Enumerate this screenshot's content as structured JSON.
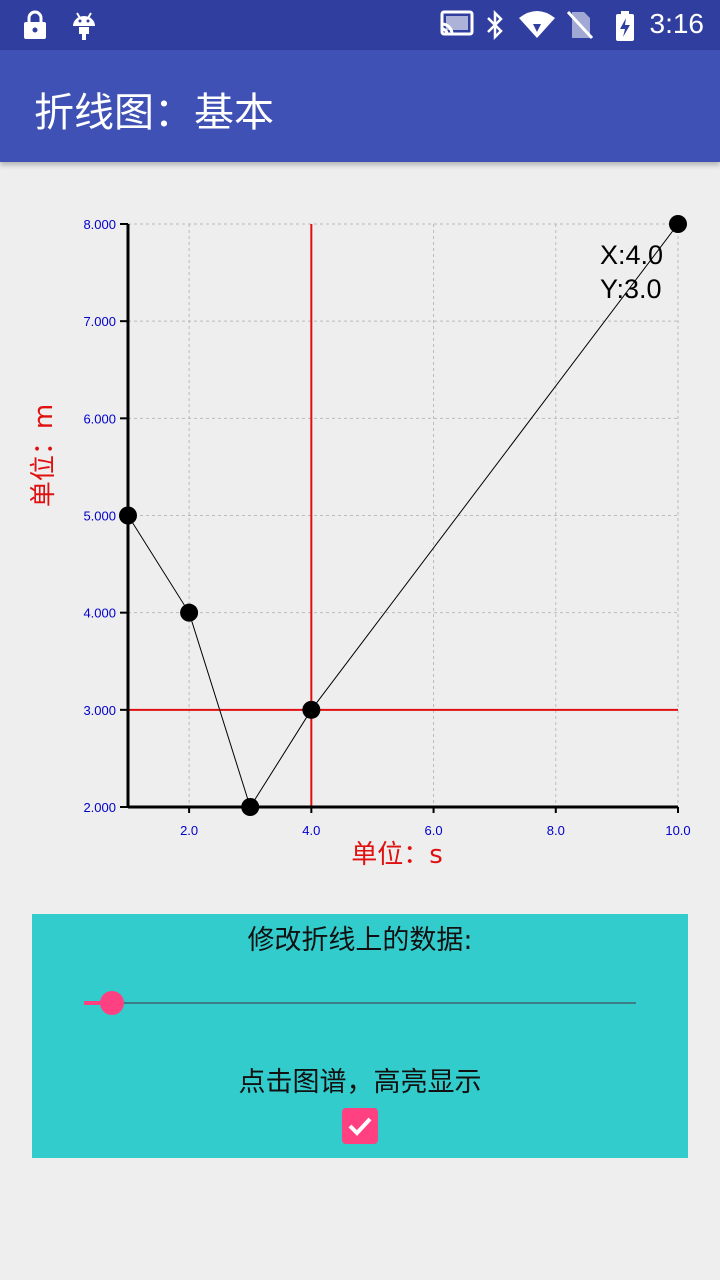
{
  "status_bar": {
    "time": "3:16",
    "icons": [
      "lock-icon",
      "android-icon",
      "cast-icon",
      "bluetooth-icon",
      "wifi-icon",
      "no-sim-icon",
      "battery-charging-icon"
    ]
  },
  "app_bar": {
    "title": "折线图：基本"
  },
  "chart_data": {
    "type": "line",
    "x": [
      1.0,
      2.0,
      3.0,
      4.0,
      10.0
    ],
    "y": [
      5.0,
      4.0,
      2.0,
      3.0,
      8.0
    ],
    "xlim": [
      1.0,
      10.0
    ],
    "ylim": [
      2.0,
      8.0
    ],
    "xticks": [
      2.0,
      4.0,
      6.0,
      8.0,
      10.0
    ],
    "yticks": [
      2.0,
      3.0,
      4.0,
      5.0,
      6.0,
      7.0,
      8.0
    ],
    "xtick_labels": [
      "2.0",
      "4.0",
      "6.0",
      "8.0",
      "10.0"
    ],
    "ytick_labels": [
      "2.000",
      "3.000",
      "4.000",
      "5.000",
      "6.000",
      "7.000",
      "8.000"
    ],
    "xlabel": "单位：s",
    "ylabel": "单位：m",
    "grid": true,
    "highlight": {
      "x": 4.0,
      "y": 3.0,
      "label_x": "X:4.0",
      "label_y": "Y:3.0"
    },
    "colors": {
      "line": "#000000",
      "marker": "#000000",
      "crosshair": "#e01010",
      "tick_label": "#0000cc",
      "axis_title": "#e01010",
      "grid": "#bbbbbb"
    }
  },
  "controls": {
    "title": "修改折线上的数据:",
    "slider_value": 0.05,
    "checkbox_label": "点击图谱，高亮显示",
    "checkbox_checked": true,
    "accent": "#ff4081",
    "panel_bg": "#33cccc"
  }
}
